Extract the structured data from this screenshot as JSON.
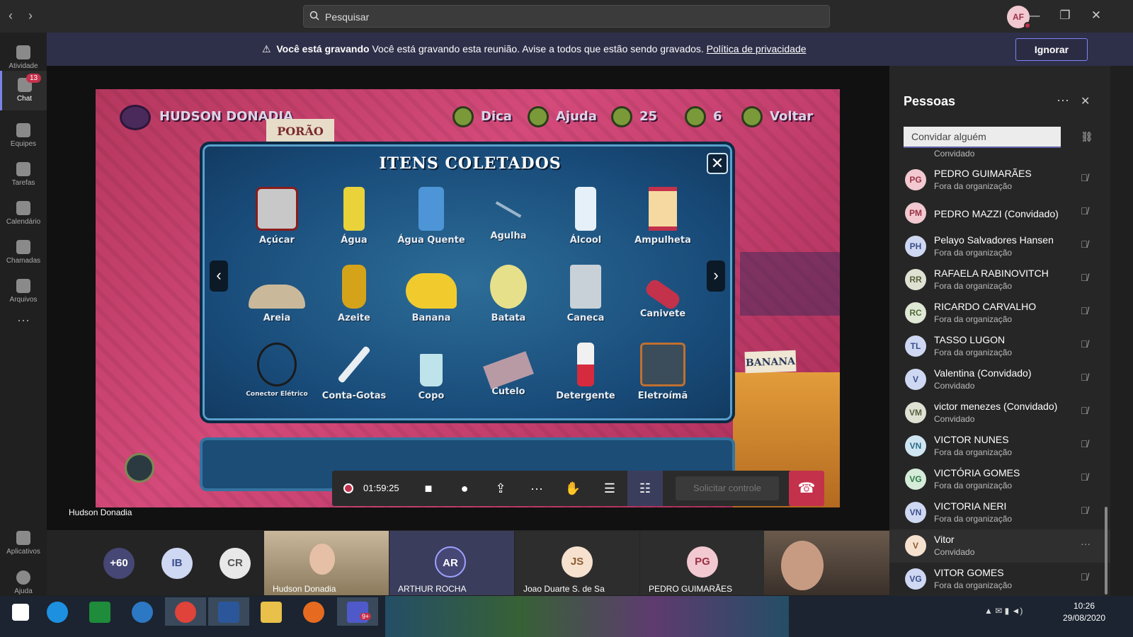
{
  "titlebar": {
    "search_placeholder": "Pesquisar",
    "user_initials": "AF"
  },
  "rail": [
    {
      "label": "Atividade",
      "icon": "bell-icon"
    },
    {
      "label": "Chat",
      "icon": "chat-icon",
      "badge": "13"
    },
    {
      "label": "Equipes",
      "icon": "teams-icon"
    },
    {
      "label": "Tarefas",
      "icon": "tasks-icon"
    },
    {
      "label": "Calendário",
      "icon": "calendar-icon"
    },
    {
      "label": "Chamadas",
      "icon": "phone-icon"
    },
    {
      "label": "Arquivos",
      "icon": "files-icon"
    },
    {
      "label": "Aplicativos",
      "icon": "apps-icon"
    },
    {
      "label": "Ajuda",
      "icon": "help-icon"
    }
  ],
  "banner": {
    "bold": "Você está gravando",
    "text": " Você está gravando esta reunião. Avise a todos que estão sendo gravados. ",
    "link": "Política de privacidade",
    "ignore": "Ignorar"
  },
  "game": {
    "player": "HUDSON DONADIA",
    "location": "PORÃO",
    "hint": "Dica",
    "help": "Ajuda",
    "stars": "25",
    "trophies": "6",
    "back": "Voltar",
    "panel_title": "ITENS COLETADOS",
    "items": [
      "Açúcar",
      "Água",
      "Água Quente",
      "Agulha",
      "Álcool",
      "Ampulheta",
      "Areia",
      "Azeite",
      "Banana",
      "Batata",
      "Caneca",
      "Canivete",
      "Conector Elétrico",
      "Conta-Gotas",
      "Copo",
      "Cutelo",
      "Detergente",
      "Eletroímã"
    ],
    "banana_sign": "BANANA"
  },
  "call": {
    "timer": "01:59:25",
    "request_control": "Solicitar controle",
    "presenter": "Hudson Donadia"
  },
  "strip": {
    "more": "+60",
    "circles": [
      "IB",
      "CR"
    ],
    "tiles": [
      {
        "name": "Hudson Donadia",
        "video": true
      },
      {
        "name": "ARTHUR ROCHA",
        "initials": "AR"
      },
      {
        "name": "Joao Duarte S. de Sa",
        "initials": "JS"
      },
      {
        "name": "PEDRO GUIMARÃES",
        "initials": "PG"
      }
    ]
  },
  "people": {
    "title": "Pessoas",
    "invite_placeholder": "Convidar alguém",
    "top_partial": "Convidado",
    "list": [
      {
        "initials": "PG",
        "name": "PEDRO GUIMARÃES",
        "sub": "Fora da organização",
        "color": "#f2c9d0",
        "fg": "#9b3045",
        "status": "#c4314b"
      },
      {
        "initials": "PM",
        "name": "PEDRO MAZZI (Convidado)",
        "sub": "",
        "color": "#f2c9d0",
        "fg": "#9b3045",
        "status": "#6bb700"
      },
      {
        "initials": "PH",
        "name": "Pelayo Salvadores Hansen",
        "sub": "Fora da organização",
        "color": "#cfd8f2",
        "fg": "#3b4e8c",
        "status": ""
      },
      {
        "initials": "RR",
        "name": "RAFAELA RABINOVITCH",
        "sub": "Fora da organização",
        "color": "#dfe2d3",
        "fg": "#55603c",
        "status": "#c4314b"
      },
      {
        "initials": "RC",
        "name": "RICARDO CARVALHO",
        "sub": "Fora da organização",
        "color": "#dfe7d5",
        "fg": "#4d6a34",
        "status": ""
      },
      {
        "initials": "TL",
        "name": "TASSO LUGON",
        "sub": "Fora da organização",
        "color": "#cfd8f2",
        "fg": "#3b4e8c",
        "status": ""
      },
      {
        "initials": "V",
        "name": "Valentina (Convidado)",
        "sub": "Convidado",
        "color": "#cfd8f2",
        "fg": "#3b4e8c",
        "status": ""
      },
      {
        "initials": "VM",
        "name": "victor menezes (Convidado)",
        "sub": "Convidado",
        "color": "#dfe2d3",
        "fg": "#55603c",
        "status": ""
      },
      {
        "initials": "VN",
        "name": "VICTOR NUNES",
        "sub": "Fora da organização",
        "color": "#cfe6f2",
        "fg": "#2f6c8c",
        "status": ""
      },
      {
        "initials": "VG",
        "name": "VICTÓRIA GOMES",
        "sub": "Fora da organização",
        "color": "#d5ecd9",
        "fg": "#2d7a45",
        "status": "#c4314b"
      },
      {
        "initials": "VN",
        "name": "VICTORIA NERI",
        "sub": "Fora da organização",
        "color": "#cfd8f2",
        "fg": "#3b4e8c",
        "status": "#c4314b"
      },
      {
        "initials": "V",
        "name": "Vitor",
        "sub": "Convidado",
        "color": "#f6e1cf",
        "fg": "#8c5a2f",
        "status": ""
      },
      {
        "initials": "VG",
        "name": "VITOR GOMES",
        "sub": "Fora da organização",
        "color": "#cfd8f2",
        "fg": "#3b4e8c",
        "status": ""
      }
    ]
  },
  "taskbar": {
    "time": "10:26",
    "date": "29/08/2020",
    "teams_badge": "9+"
  }
}
